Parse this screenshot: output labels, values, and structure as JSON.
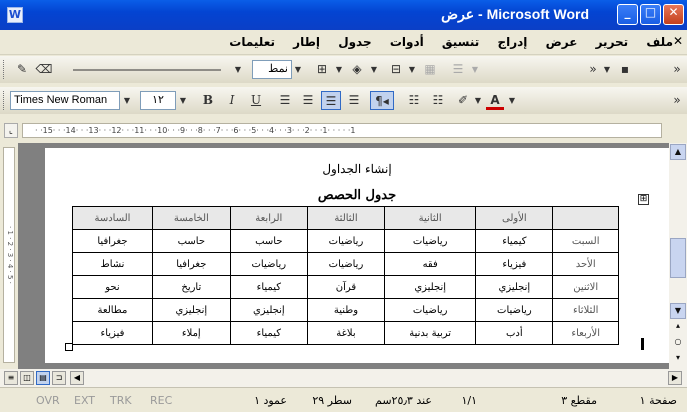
{
  "window": {
    "title": "Microsoft Word - عرض",
    "app_icon": "W",
    "buttons": {
      "minimize": "_",
      "maximize": "□",
      "close": "✕"
    }
  },
  "menu": {
    "items": [
      "ملف",
      "تحرير",
      "عرض",
      "إدراج",
      "تنسيق",
      "أدوات",
      "جدول",
      "إطار",
      "تعليمات"
    ],
    "close_doc": "✕"
  },
  "toolbar1": {
    "style_combo": "نمط",
    "font_size_combo": ""
  },
  "toolbar2": {
    "font_name": "Times New Roman",
    "font_size": "١٢",
    "bold": "B",
    "italic": "I",
    "underline": "U"
  },
  "ruler": {
    "marks": "· ·15· · ·14· · ·13· · ·12· · ·11· · ·10· · ·9· · ·8· · ·7· · ·6· · ·5· · ·4· · ·3· · ·2· · ·1· · · · ·1"
  },
  "vruler": {
    "marks": "· 1 · 2 · 3 · 4 · 5 ·"
  },
  "document": {
    "heading": "إنشاء الجداول",
    "subheading": "جدول الحصص",
    "table_handle": "⊞",
    "table": {
      "header": [
        "",
        "الأولى",
        "الثانية",
        "الثالثة",
        "الرابعة",
        "الخامسة",
        "السادسة"
      ],
      "rows": [
        [
          "السبت",
          "كيمياء",
          "رياضيات",
          "رياضيات",
          "حاسب",
          "حاسب",
          "جغرافيا"
        ],
        [
          "الأحد",
          "فيزياء",
          "فقه",
          "رياضيات",
          "رياضيات",
          "جغرافيا",
          "نشاط"
        ],
        [
          "الاثنين",
          "إنجليزي",
          "إنجليزي",
          "قرآن",
          "كيمياء",
          "تاريخ",
          "نحو"
        ],
        [
          "الثلاثاء",
          "رياضيات",
          "رياضيات",
          "وطنية",
          "إنجليزي",
          "إنجليزي",
          "مطالعة"
        ],
        [
          "الأربعاء",
          "أدب",
          "تربية بدنية",
          "بلاغة",
          "كيمياء",
          "إملاء",
          "فيزياء"
        ]
      ]
    }
  },
  "status": {
    "page": "صفحة ١",
    "section": "مقطع ٣",
    "pages": "١/١",
    "at": "عند ٢٥٫٣سم",
    "line": "سطر ٢٩",
    "column": "عمود ١",
    "rec": "REC",
    "trk": "TRK",
    "ext": "EXT",
    "ovr": "OVR"
  }
}
